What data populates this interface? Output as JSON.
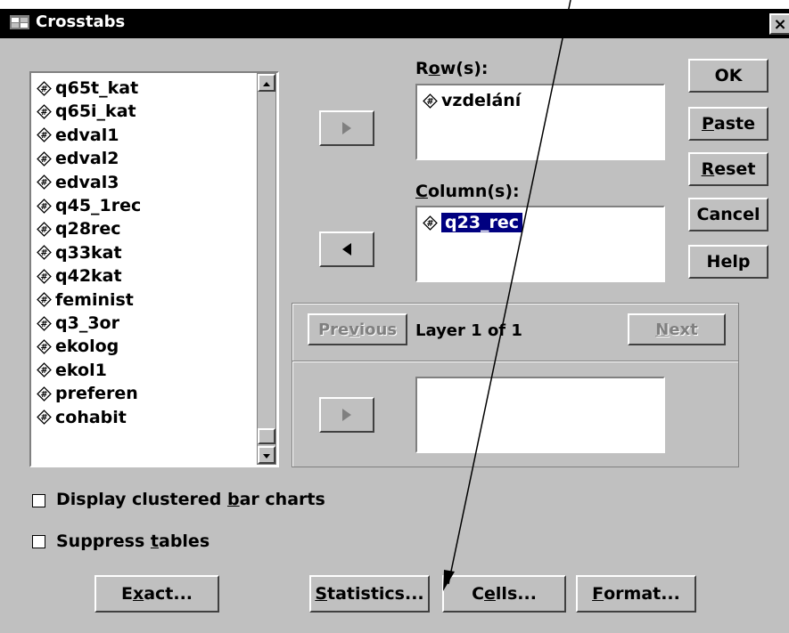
{
  "window": {
    "title": "Crosstabs",
    "close": "×"
  },
  "source_list": {
    "items": [
      "q65t_kat",
      "q65i_kat",
      "edval1",
      "edval2",
      "edval3",
      "q45_1rec",
      "q28rec",
      "q33kat",
      "q42kat",
      "feminist",
      "q3_3or",
      "ekolog",
      "ekol1",
      "preferen",
      "cohabit"
    ]
  },
  "rows": {
    "label": "Row(s):",
    "items": [
      "vzdelání"
    ]
  },
  "columns": {
    "label": "Column(s):",
    "items": [
      "q23_rec"
    ]
  },
  "layer": {
    "previous": "Previous",
    "text": "Layer 1 of 1",
    "next": "Next"
  },
  "buttons": {
    "ok": "OK",
    "paste": "Paste",
    "reset": "Reset",
    "cancel": "Cancel",
    "help": "Help"
  },
  "options": {
    "clustered": "Display clustered bar charts",
    "suppress": "Suppress tables"
  },
  "bottom_buttons": {
    "exact": "Exact...",
    "statistics": "Statistics...",
    "cells": "Cells...",
    "format": "Format..."
  }
}
